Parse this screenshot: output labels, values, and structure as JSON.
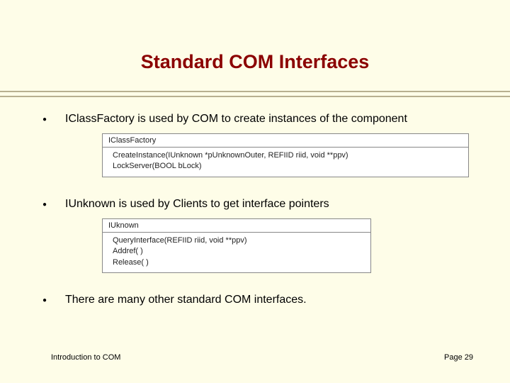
{
  "title": "Standard COM Interfaces",
  "bullets": [
    {
      "text": "IClassFactory is used by COM to create instances of the component"
    },
    {
      "text": "IUnknown is used by Clients to get interface pointers"
    },
    {
      "text": "There are many other standard COM interfaces."
    }
  ],
  "tables": [
    {
      "header": "IClassFactory",
      "lines": [
        "CreateInstance(IUnknown *pUnknownOuter, REFIID riid, void **ppv)",
        "LockServer(BOOL bLock)"
      ]
    },
    {
      "header": "IUknown",
      "lines": [
        "QueryInterface(REFIID riid, void **ppv)",
        "Addref( )",
        "Release( )"
      ]
    }
  ],
  "footer": {
    "left": "Introduction to COM",
    "right": "Page 29"
  }
}
